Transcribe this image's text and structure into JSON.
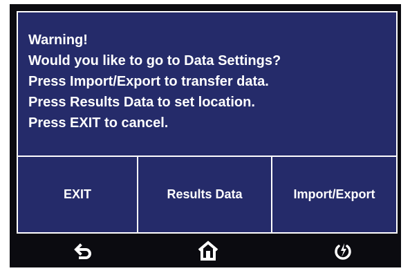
{
  "dialog": {
    "lines": [
      "Warning!",
      "Would you like to go to Data Settings?",
      "Press Import/Export to transfer data.",
      "Press Results Data to set location.",
      "Press EXIT to cancel."
    ]
  },
  "buttons": {
    "exit_label": "EXIT",
    "results_label": "Results Data",
    "import_export_label": "Import/Export"
  },
  "navbar": {
    "icons": [
      "back-icon",
      "home-icon",
      "power-icon"
    ]
  },
  "colors": {
    "screen_background": "#252b6a",
    "frame": "#0b0b10",
    "text": "#ffffff"
  }
}
